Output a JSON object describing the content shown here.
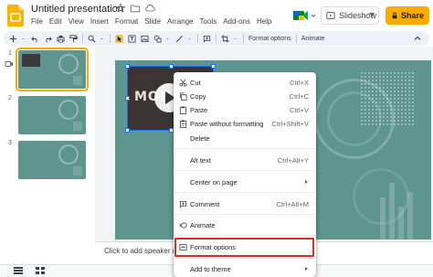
{
  "app": {
    "doc_title": "Untitled presentation",
    "brand_color": "#f9ab00",
    "slide_color": "#5f958f",
    "highlight_color": "#d93025"
  },
  "menubar": [
    "File",
    "Edit",
    "View",
    "Insert",
    "Format",
    "Slide",
    "Arrange",
    "Tools",
    "Add-ons",
    "Help"
  ],
  "header": {
    "slideshow_label": "Slideshow",
    "share_label": "Share"
  },
  "toolbar": {
    "format_options": "Format options",
    "animate": "Animate"
  },
  "filmstrip": {
    "slides": [
      {
        "num": "1",
        "selected": true
      },
      {
        "num": "2",
        "selected": false
      },
      {
        "num": "3",
        "selected": false
      }
    ]
  },
  "slide": {
    "video_title": "MON"
  },
  "notes": {
    "placeholder": "Click to add speaker no"
  },
  "context_menu": {
    "items": [
      {
        "label": "Cut",
        "shortcut": "Ctrl+X",
        "icon": "scissors-icon"
      },
      {
        "label": "Copy",
        "shortcut": "Ctrl+C",
        "icon": "copy-icon"
      },
      {
        "label": "Paste",
        "shortcut": "Ctrl+V",
        "icon": "paste-icon"
      },
      {
        "label": "Paste without formatting",
        "shortcut": "Ctrl+Shift+V",
        "icon": "paste-plain-icon"
      },
      {
        "label": "Delete",
        "shortcut": "",
        "icon": ""
      },
      {
        "label": "Alt text",
        "shortcut": "Ctrl+Alt+Y",
        "icon": ""
      },
      {
        "label": "Center on page",
        "shortcut": "",
        "icon": ""
      },
      {
        "label": "Comment",
        "shortcut": "Ctrl+Alt+M",
        "icon": "comment-icon"
      },
      {
        "label": "Animate",
        "shortcut": "",
        "icon": "animate-icon"
      },
      {
        "label": "Format options",
        "shortcut": "",
        "icon": "format-options-icon"
      },
      {
        "label": "Add to theme",
        "shortcut": "",
        "icon": ""
      }
    ]
  }
}
